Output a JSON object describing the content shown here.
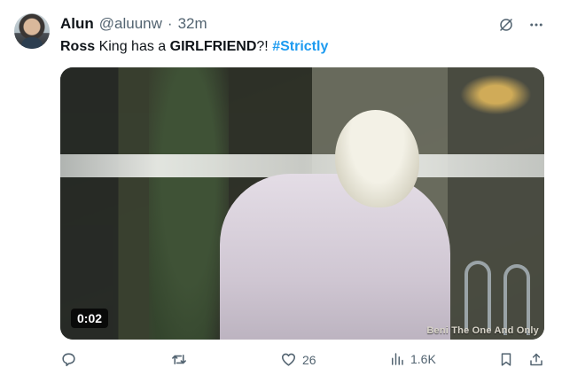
{
  "tweet": {
    "author_name": "Alun",
    "handle": "@aluunw",
    "separator": "·",
    "time": "32m",
    "text": {
      "part1": "Ross",
      "part2": " King has a ",
      "part3": "GIRLFRIEND",
      "part4": "?! ",
      "hashtag": "#Strictly"
    }
  },
  "media": {
    "duration": "0:02",
    "watermark": "Beni The One And Only"
  },
  "actions": {
    "reply_count": "",
    "retweet_count": "",
    "like_count": "26",
    "views_count": "1.6K"
  },
  "icons": {
    "grok": "grok-icon",
    "more": "more-icon",
    "reply": "reply-icon",
    "retweet": "retweet-icon",
    "like": "heart-icon",
    "views": "views-icon",
    "bookmark": "bookmark-icon",
    "share": "share-icon"
  },
  "colors": {
    "text": "#0f1419",
    "secondary": "#536471",
    "link": "#1d9bf0"
  }
}
